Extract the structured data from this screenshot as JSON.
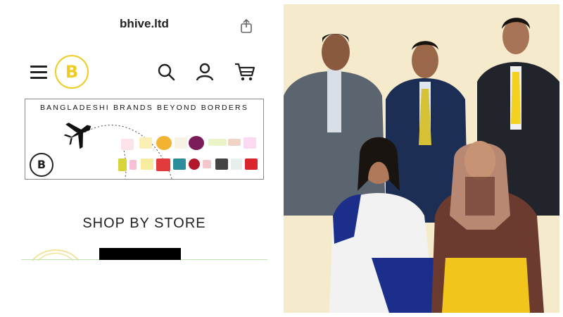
{
  "browser": {
    "url": "bhive.ltd"
  },
  "header": {
    "logo_letter": "B"
  },
  "banner": {
    "title": "BANGLADESHI BRANDS BEYOND BORDERS",
    "logo_letter": "B"
  },
  "shop": {
    "title": "SHOP BY STORE"
  },
  "colors": {
    "brand_yellow": "#f0cc23",
    "divider_green": "#bfe3b2"
  },
  "icons": [
    "menu-icon",
    "search-icon",
    "user-icon",
    "cart-icon",
    "share-icon",
    "airplane-icon"
  ]
}
